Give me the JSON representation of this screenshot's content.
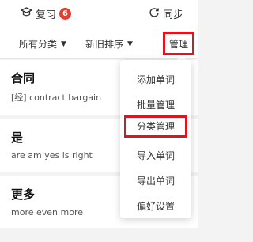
{
  "topbar": {
    "review_label": "复习",
    "review_count": "6",
    "sync_label": "同步"
  },
  "filters": {
    "category_label": "所有分类",
    "sort_label": "新旧排序",
    "manage_label": "管理"
  },
  "words": [
    {
      "word": "合同",
      "definition": "[经] contract bargain"
    },
    {
      "word": "是",
      "definition": "are am yes is right"
    },
    {
      "word": "更多",
      "definition": "more even more"
    }
  ],
  "menu": {
    "items": [
      {
        "label": "添加单词"
      },
      {
        "label": "批量管理"
      },
      {
        "label": "分类管理"
      },
      {
        "label": "导入单词"
      },
      {
        "label": "导出单词"
      },
      {
        "label": "偏好设置"
      }
    ]
  },
  "colors": {
    "badge": "#e53b30",
    "highlight_border": "#e0141e"
  }
}
